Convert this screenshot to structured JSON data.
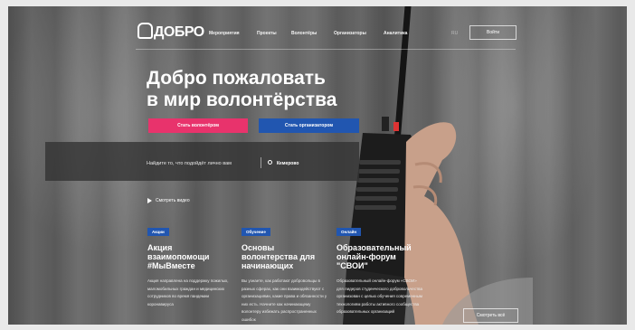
{
  "header": {
    "logo": "ДОБРО",
    "logo_sub": "",
    "nav": [
      "Мероприятия",
      "Проекты",
      "Волонтёры",
      "Организаторы",
      "Аналитика"
    ],
    "lang": "RU",
    "login": "Войти"
  },
  "hero": {
    "title": "Добро пожаловать\nв мир волонтёрства",
    "volunteer_button": "Стать волонтёром",
    "organizer_button": "Стать организатором"
  },
  "search": {
    "text": "Найдите то, что подойдёт лично вам",
    "city": "Кемерово"
  },
  "video_link": "Смотреть видео",
  "cards": [
    {
      "tag": "Акции",
      "title": "Акция взаимопомощи #МыВместе",
      "text": "Акция направлена на поддержку пожилых, маломобильных граждан и медицинских сотрудников во время пандемии коронавируса"
    },
    {
      "tag": "Обучение",
      "title": "Основы волонтерства для начинающих",
      "text": "Вы узнаете, как работают добровольцы в разных сферах, как они взаимодействуют с организациями, какие права и обязанности у них есть. Начните как начинающему волонтеру избежать распространенных ошибок"
    },
    {
      "tag": "Онлайн",
      "title": "Образовательный онлайн-форум \"СВОИ\"",
      "text": "Образовательный онлайн-форум «СВОИ» для лидеров студенческого добровольчества организован с целью обучения современным технологиям работы активного сообщества образовательных организаций"
    }
  ],
  "all_button": "Смотреть всё",
  "colors": {
    "pink": "#e8336c",
    "blue": "#2156b0"
  }
}
